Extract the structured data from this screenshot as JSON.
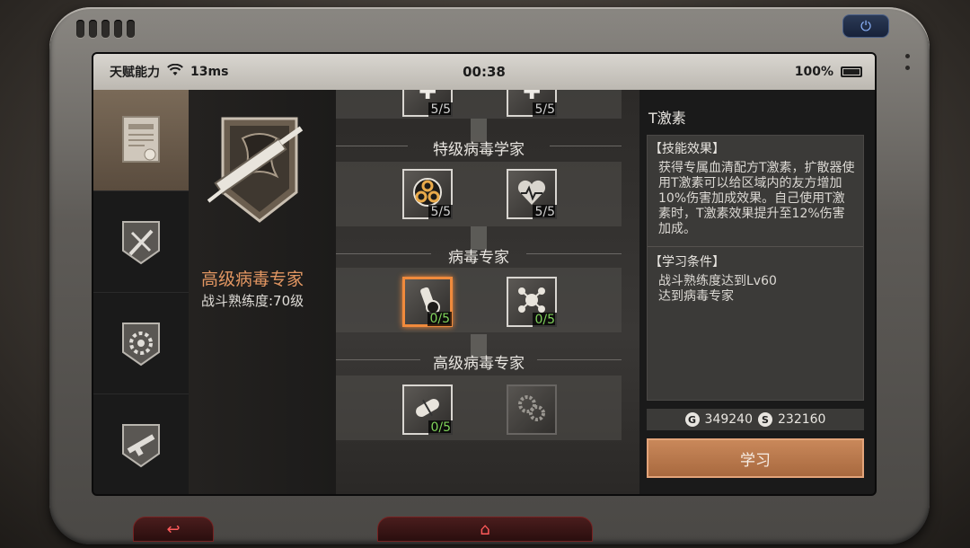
{
  "status": {
    "app_name": "天赋能力",
    "ping": "13ms",
    "time": "00:38",
    "battery": "100%"
  },
  "profile": {
    "name": "高级病毒专家",
    "level": "战斗熟练度:70级"
  },
  "tiers": [
    {
      "title": "",
      "nodes": [
        {
          "count": "5/5"
        },
        {
          "count": "5/5"
        }
      ]
    },
    {
      "title": "特级病毒学家",
      "nodes": [
        {
          "icon": "biohazard-icon",
          "count": "5/5"
        },
        {
          "icon": "heart-pulse-icon",
          "count": "5/5"
        }
      ]
    },
    {
      "title": "病毒专家",
      "nodes": [
        {
          "icon": "serum-vial-icon",
          "count": "0/5"
        },
        {
          "icon": "molecule-icon",
          "count": "0/5"
        }
      ]
    },
    {
      "title": "高级病毒专家",
      "nodes": [
        {
          "icon": "capsule-icon",
          "count": "0/5"
        },
        {
          "icon": "gear-cluster-icon",
          "count": ""
        }
      ]
    }
  ],
  "info": {
    "skill_name": "T激素",
    "effect_header": "【技能效果】",
    "effect_text": "获得专属血清配方T激素，扩散器使用T激素可以给区域内的友方增加10%伤害加成效果。自己使用T激素时，T激素效果提升至12%伤害加成。",
    "condition_header": "【学习条件】",
    "condition_1": "战斗熟练度达到Lv60",
    "condition_2": "达到病毒专家",
    "cost_gold": "349240",
    "cost_silver": "232160",
    "coin_gold_symbol": "G",
    "coin_silver_symbol": "S",
    "learn_label": "学习"
  },
  "device": {
    "back_icon": "↩",
    "home_icon": "⌂",
    "power_icon": "⏻"
  }
}
